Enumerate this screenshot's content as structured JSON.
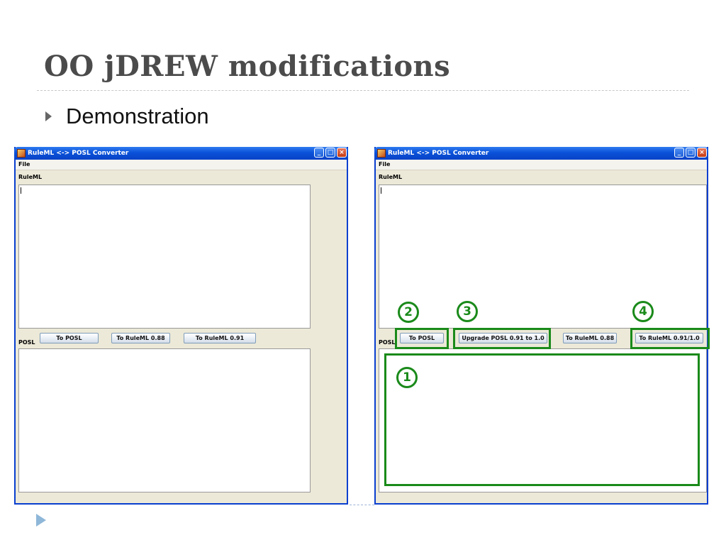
{
  "slide": {
    "title": "OO jDREW modifications",
    "bullet": "Demonstration"
  },
  "window_left": {
    "title": "RuleML <-> POSL Converter",
    "menu": [
      "File"
    ],
    "ruleml_label": "RuleML",
    "posl_label": "POSL",
    "buttons": [
      "To POSL",
      "To RuleML 0.88",
      "To RuleML 0.91"
    ]
  },
  "window_right": {
    "title": "RuleML <-> POSL Converter",
    "menu": [
      "File"
    ],
    "ruleml_label": "RuleML",
    "posl_label": "POSL",
    "buttons": [
      "To POSL",
      "Upgrade POSL 0.91 to 1.0",
      "To RuleML 0.88",
      "To RuleML 0.91/1.0"
    ]
  },
  "annotations": [
    "1",
    "2",
    "3",
    "4"
  ],
  "icons": [
    "java-app-icon",
    "minimize-icon",
    "maximize-icon",
    "close-icon",
    "bullet-arrow-icon",
    "nav-arrow-icon"
  ],
  "colors": {
    "highlight": "#1a8a1a",
    "titlebar": "#0a52d9",
    "title_text": "#4b4b4b"
  }
}
